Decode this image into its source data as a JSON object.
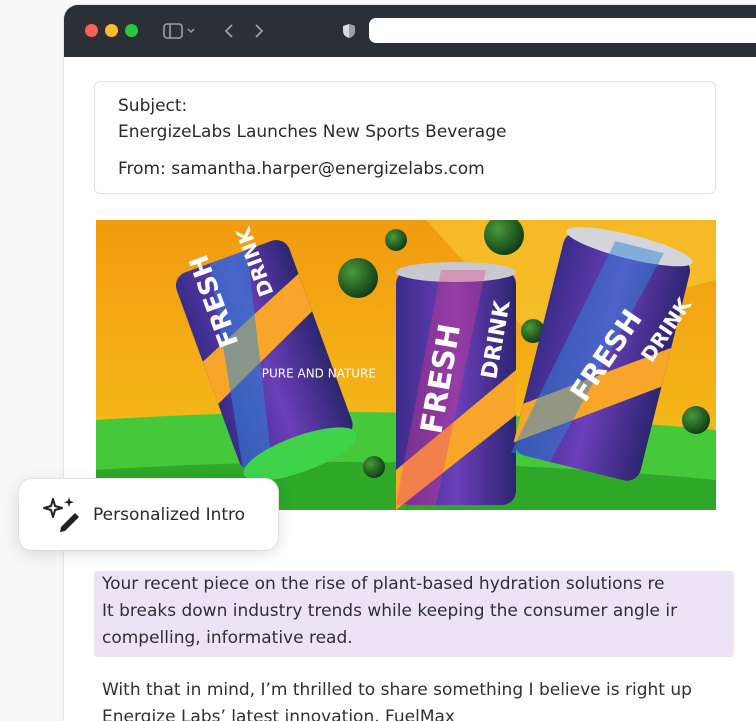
{
  "email": {
    "subject_label": "Subject:",
    "subject": "EnergizeLabs Launches New Sports Beverage",
    "from": "From: samantha.harper@energizelabs.com"
  },
  "hero": {
    "can_brand_1": "FRESH",
    "can_brand_2": "DRINK",
    "can_tagline": "PURE AND NATURE"
  },
  "badge": {
    "label": "Personalized Intro",
    "icon": "sparkle-pen-icon"
  },
  "body": {
    "highlight_lines": [
      "Your recent piece on the rise of plant-based hydration solutions re",
      "It breaks down industry trends while keeping the consumer angle ir",
      "compelling, informative read."
    ],
    "para2_lines": [
      "With that in mind, I’m thrilled to share something I believe is right up",
      "Energize Labs’ latest innovation, FuelMax"
    ]
  },
  "colors": {
    "titlebar": "#2b2f36",
    "highlight": "#ece4f6",
    "hero_bg": "#f2a516",
    "grass": "#3fcf2a"
  }
}
